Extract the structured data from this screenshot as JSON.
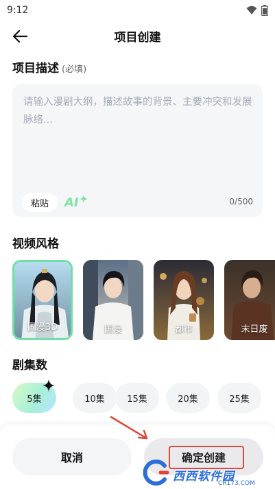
{
  "status_bar": {
    "time": "9:12"
  },
  "header": {
    "title": "项目创建",
    "back_icon": "arrow-left-icon"
  },
  "description": {
    "title": "项目描述",
    "required_hint": "(必填)",
    "placeholder": "请输入漫剧大纲，描述故事的背景、主要冲突和发展脉络...",
    "value": "",
    "paste_label": "粘贴",
    "ai_label": "AI",
    "char_count": "0/500"
  },
  "video_style": {
    "title": "视频风格",
    "options": [
      {
        "label": "国漫3D",
        "selected": true
      },
      {
        "label": "国漫",
        "selected": false
      },
      {
        "label": "都市",
        "selected": false
      },
      {
        "label": "末日废",
        "selected": false
      }
    ]
  },
  "episodes": {
    "title": "剧集数",
    "options": [
      {
        "label": "5集",
        "selected": true
      },
      {
        "label": "10集",
        "selected": false
      },
      {
        "label": "15集",
        "selected": false
      },
      {
        "label": "20集",
        "selected": false
      },
      {
        "label": "25集",
        "selected": false
      }
    ]
  },
  "footer": {
    "cancel_label": "取消",
    "confirm_label": "确定创建"
  },
  "watermark": {
    "text": "西西软件园",
    "sub": "CR173.COM"
  },
  "colors": {
    "accent_green": "#6fe0a5",
    "annotation_red": "#e0453a",
    "watermark_blue": "#2d6fd6"
  }
}
